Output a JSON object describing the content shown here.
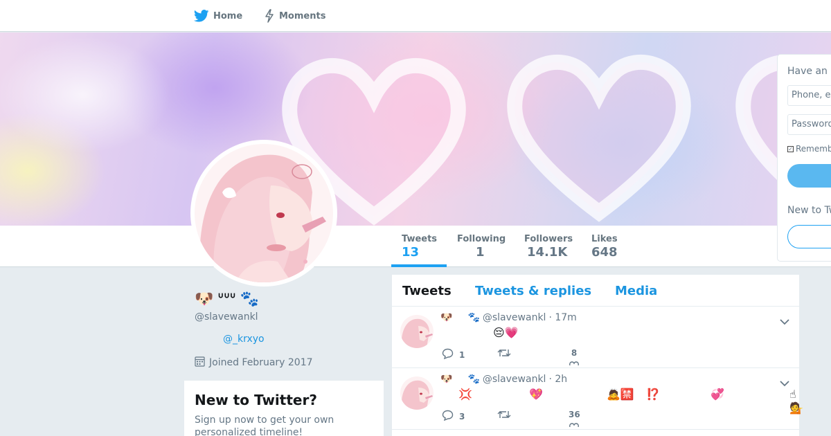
{
  "nav": {
    "home_label": "Home",
    "moments_label": "Moments",
    "home_icon": "twitter-bird-icon",
    "moments_icon": "lightning-icon"
  },
  "profile": {
    "display_name": "ᐡᐡᐡ",
    "name_prefix_emoji": "🐶",
    "name_suffix_emoji": "🐾",
    "handle": "@slavewankl",
    "bio_link": "@_krxyo",
    "joined": "Joined February 2017"
  },
  "stats": [
    {
      "label": "Tweets",
      "value": "13",
      "active": true
    },
    {
      "label": "Following",
      "value": "1",
      "active": false
    },
    {
      "label": "Followers",
      "value": "14.1K",
      "active": false
    },
    {
      "label": "Likes",
      "value": "648",
      "active": false
    }
  ],
  "signup_card": {
    "title": "New to Twitter?",
    "text": "Sign up now to get your own personalized timeline!"
  },
  "timeline": {
    "tabs": [
      "Tweets",
      "Tweets & replies",
      "Media"
    ],
    "tweets": [
      {
        "prefix_emoji": "🐶",
        "paw_emoji": "🐾",
        "handle": "@slavewankl",
        "time": "· 17m",
        "content": [
          "😔💗"
        ],
        "replies": "1",
        "retweets": "",
        "likes": "8"
      },
      {
        "prefix_emoji": "🐶",
        "paw_emoji": "🐾",
        "handle": "@slavewankl",
        "time": "· 2h",
        "content": [
          "💢",
          "💖",
          "🙇🈲",
          "⁉️",
          "💞",
          "☝💁"
        ],
        "replies": "3",
        "retweets": "",
        "likes": "36"
      }
    ]
  },
  "login": {
    "title": "Have an account?",
    "phone_placeholder": "Phone, email or username",
    "password_placeholder": "Password",
    "remember_label": "Remember me",
    "new_label": "New to Twitter?"
  },
  "colors": {
    "accent": "#1da1f2",
    "link": "#1b95e0",
    "background": "#e6ecf0"
  }
}
